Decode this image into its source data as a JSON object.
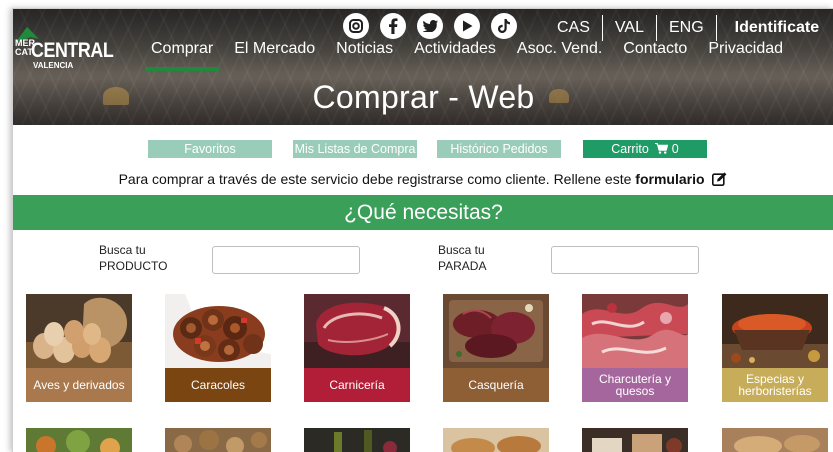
{
  "brand": {
    "line1": "MER",
    "line2": "CAT",
    "name": "CENTRAL",
    "city": "VALENCIA"
  },
  "social_icons": [
    "instagram-icon",
    "facebook-icon",
    "twitter-icon",
    "youtube-icon",
    "tiktok-icon"
  ],
  "languages": [
    "CAS",
    "VAL",
    "ENG"
  ],
  "login_label": "Identificate",
  "nav": [
    "Comprar",
    "El Mercado",
    "Noticias",
    "Actividades",
    "Asoc. Vend.",
    "Contacto",
    "Privacidad"
  ],
  "page_title": "Comprar - Web",
  "actions": {
    "favorites": "Favoritos",
    "lists": "Mis Listas de Compra",
    "history": "Histórico Pedidos",
    "cart": "Carrito",
    "cart_count": "0"
  },
  "notice": {
    "text": "Para comprar a través de este servicio debe registrarse como cliente. Rellene este ",
    "link": "formulario"
  },
  "banner": "¿Qué necesitas?",
  "search": {
    "product_label_1": "Busca tu",
    "product_label_2": "PRODUCTO",
    "product_value": "",
    "stall_label_1": "Busca tu",
    "stall_label_2": "PARADA",
    "stall_value": ""
  },
  "categories": [
    {
      "name": "Aves y derivados",
      "color": "#a9784c"
    },
    {
      "name": "Caracoles",
      "color": "#7a4511"
    },
    {
      "name": "Carnicería",
      "color": "#b21e38"
    },
    {
      "name": "Casquería",
      "color": "#8e5e35"
    },
    {
      "name": "Charcutería y quesos",
      "color": "#a5669d"
    },
    {
      "name": "Especias y herboristerías",
      "color": "#c7ad5a"
    }
  ],
  "colors": {
    "accent_green": "#3a9f59",
    "button_light": "#99cdb9",
    "button_dark": "#1f9b66",
    "nav_active": "#1f8a3c"
  }
}
